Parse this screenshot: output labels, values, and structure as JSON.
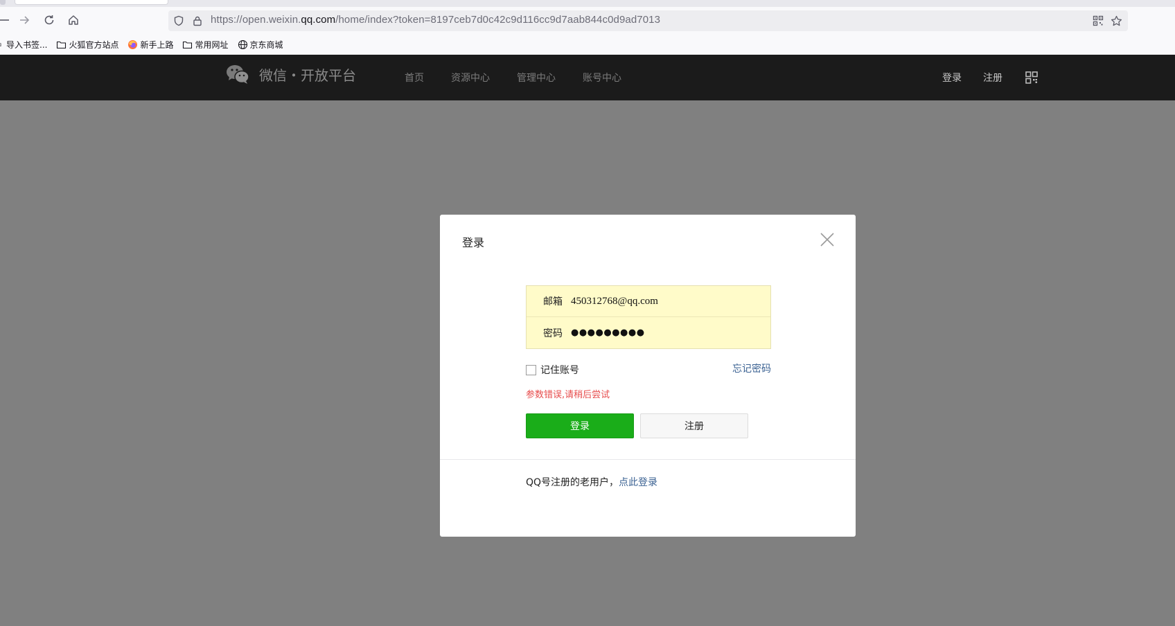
{
  "browser": {
    "url_prefix": "https://open.weixin.",
    "url_host": "qq.com",
    "url_path": "/home/index?token=8197ceb7d0c42c9d116cc9d7aab844c0d9ad7013",
    "bookmarks": [
      {
        "label": "导入书签...",
        "icon": "import-icon"
      },
      {
        "label": "火狐官方站点",
        "icon": "folder-icon"
      },
      {
        "label": "新手上路",
        "icon": "firefox-icon"
      },
      {
        "label": "常用网址",
        "icon": "folder-icon"
      },
      {
        "label": "京东商城",
        "icon": "globe-icon"
      }
    ]
  },
  "site": {
    "logo_text": "微信・开放平台",
    "nav": [
      "首页",
      "资源中心",
      "管理中心",
      "账号中心"
    ],
    "login": "登录",
    "register": "注册"
  },
  "modal": {
    "title": "登录",
    "email_label": "邮箱",
    "email_value": "450312768@qq.com",
    "password_label": "密码",
    "password_value": "●●●●●●●●●",
    "remember_label": "记住账号",
    "forgot_label": "忘记密码",
    "error_text": "参数错误,请稍后尝试",
    "login_button": "登录",
    "register_button": "注册",
    "qq_text": "QQ号注册的老用户，",
    "qq_link": "点此登录"
  },
  "colors": {
    "accent_green": "#1aad19",
    "link_blue": "#3a6192",
    "error_red": "#e74c4c",
    "header_bg": "#1b1b1b",
    "field_bg": "#fffbc9"
  }
}
